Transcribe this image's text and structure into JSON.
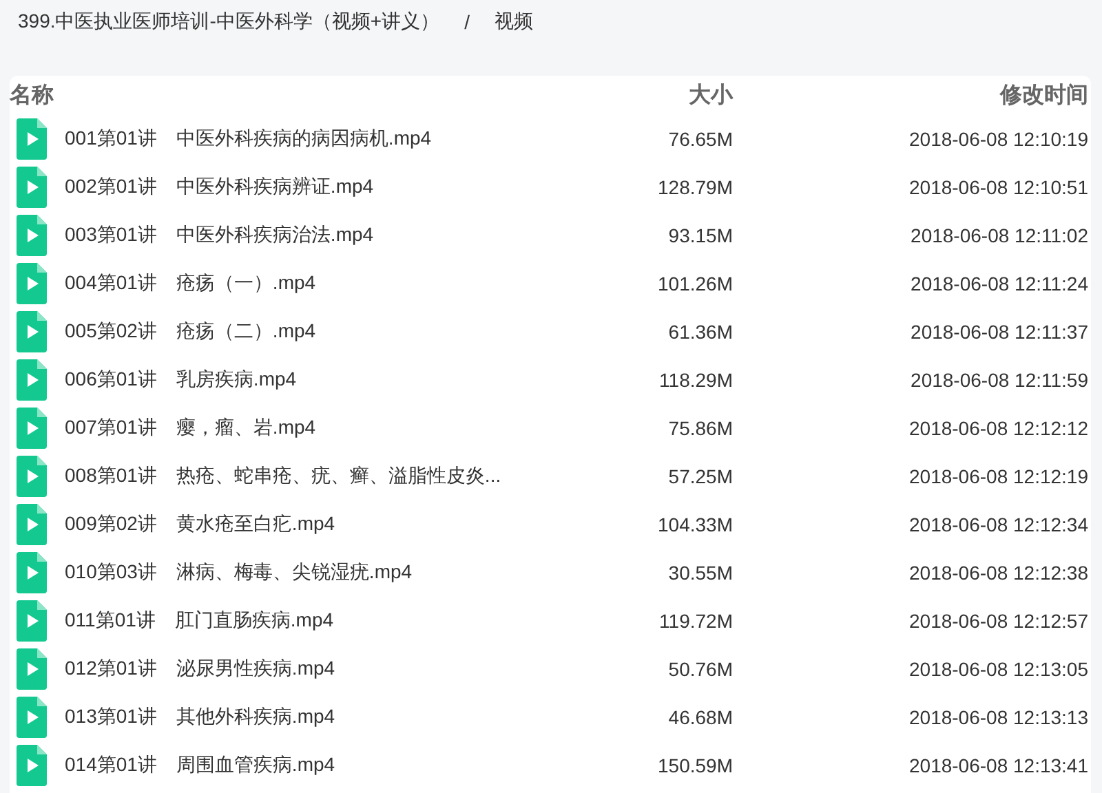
{
  "breadcrumb": {
    "items": [
      "399.中医执业医师培训-中医外科学（视频+讲义）",
      "视频"
    ],
    "separator": "/"
  },
  "table": {
    "columns": [
      "名称",
      "大小",
      "修改时间"
    ],
    "rows": [
      {
        "name": "001第01讲　中医外科疾病的病因病机.mp4",
        "size": "76.65M",
        "modified": "2018-06-08 12:10:19"
      },
      {
        "name": "002第01讲　中医外科疾病辨证.mp4",
        "size": "128.79M",
        "modified": "2018-06-08 12:10:51"
      },
      {
        "name": "003第01讲　中医外科疾病治法.mp4",
        "size": "93.15M",
        "modified": "2018-06-08 12:11:02"
      },
      {
        "name": "004第01讲　疮疡（一）.mp4",
        "size": "101.26M",
        "modified": "2018-06-08 12:11:24"
      },
      {
        "name": "005第02讲　疮疡（二）.mp4",
        "size": "61.36M",
        "modified": "2018-06-08 12:11:37"
      },
      {
        "name": "006第01讲　乳房疾病.mp4",
        "size": "118.29M",
        "modified": "2018-06-08 12:11:59"
      },
      {
        "name": "007第01讲　瘿，瘤、岩.mp4",
        "size": "75.86M",
        "modified": "2018-06-08 12:12:12"
      },
      {
        "name": "008第01讲　热疮、蛇串疮、疣、癣、溢脂性皮炎...",
        "size": "57.25M",
        "modified": "2018-06-08 12:12:19"
      },
      {
        "name": "009第02讲　黄水疮至白疕.mp4",
        "size": "104.33M",
        "modified": "2018-06-08 12:12:34"
      },
      {
        "name": "010第03讲　淋病、梅毒、尖锐湿疣.mp4",
        "size": "30.55M",
        "modified": "2018-06-08 12:12:38"
      },
      {
        "name": "011第01讲　肛门直肠疾病.mp4",
        "size": "119.72M",
        "modified": "2018-06-08 12:12:57"
      },
      {
        "name": "012第01讲　泌尿男性疾病.mp4",
        "size": "50.76M",
        "modified": "2018-06-08 12:13:05"
      },
      {
        "name": "013第01讲　其他外科疾病.mp4",
        "size": "46.68M",
        "modified": "2018-06-08 12:13:13"
      },
      {
        "name": "014第01讲　周围血管疾病.mp4",
        "size": "150.59M",
        "modified": "2018-06-08 12:13:41"
      }
    ]
  }
}
